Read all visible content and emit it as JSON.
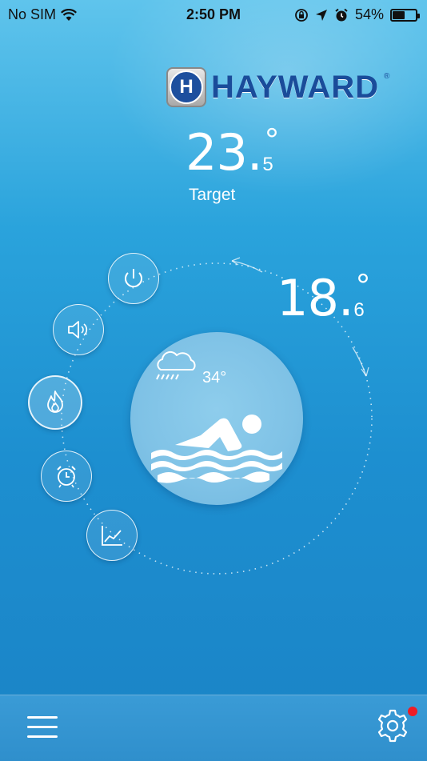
{
  "status_bar": {
    "carrier": "No SIM",
    "time": "2:50 PM",
    "battery_percent": "54%",
    "battery_level": 0.54,
    "icons": [
      "wifi-icon",
      "rotation-lock-icon",
      "location-icon",
      "alarm-icon",
      "battery-icon"
    ]
  },
  "brand": {
    "badge_letter": "H",
    "name": "HAYWARD",
    "registered": "®"
  },
  "target_temp": {
    "whole": "23.",
    "degree": "°",
    "decimal": "5",
    "label": "Target"
  },
  "water_temp": {
    "whole": "18.",
    "degree": "°",
    "decimal": "6"
  },
  "weather": {
    "icon": "rain-cloud-icon",
    "temperature": "34°"
  },
  "controls": [
    {
      "name": "power-button",
      "icon": "power-icon",
      "active": false
    },
    {
      "name": "sound-button",
      "icon": "speaker-icon",
      "active": false
    },
    {
      "name": "heat-button",
      "icon": "flame-icon",
      "active": true
    },
    {
      "name": "timer-button",
      "icon": "alarm-clock-icon",
      "active": false
    },
    {
      "name": "chart-button",
      "icon": "line-chart-icon",
      "active": false
    }
  ],
  "center_icon": "swimmer-icon",
  "bottom_bar": {
    "menu_icon": "hamburger-menu-icon",
    "settings_icon": "gear-icon",
    "has_notification": true
  },
  "colors": {
    "brand_blue": "#1a4c9a",
    "notification_red": "#ef1c25",
    "background_top": "#5fc4ec",
    "background_bottom": "#1a83c6"
  }
}
